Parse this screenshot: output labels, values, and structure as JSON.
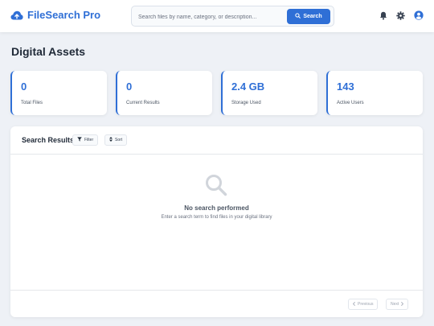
{
  "app": {
    "name": "FileSearch Pro"
  },
  "search": {
    "placeholder": "Search files by name, category, or description...",
    "value": "",
    "button_label": "Search"
  },
  "page": {
    "title": "Digital Assets"
  },
  "stats": [
    {
      "value": "0",
      "label": "Total Files"
    },
    {
      "value": "0",
      "label": "Current Results"
    },
    {
      "value": "2.4 GB",
      "label": "Storage Used"
    },
    {
      "value": "143",
      "label": "Active Users"
    }
  ],
  "results": {
    "title": "Search Results",
    "filter_label": "Filter",
    "sort_label": "Sort",
    "empty_title": "No search performed",
    "empty_desc": "Enter a search term to find files in your digital library",
    "prev_label": "Previous",
    "next_label": "Next"
  },
  "colors": {
    "accent": "#2f6fd6",
    "background": "#eef1f6"
  },
  "icons": [
    "cloud-upload-icon",
    "search-icon",
    "bell-icon",
    "gear-icon",
    "user-circle-icon",
    "filter-icon",
    "sort-icon",
    "chevron-left-icon",
    "chevron-right-icon"
  ]
}
